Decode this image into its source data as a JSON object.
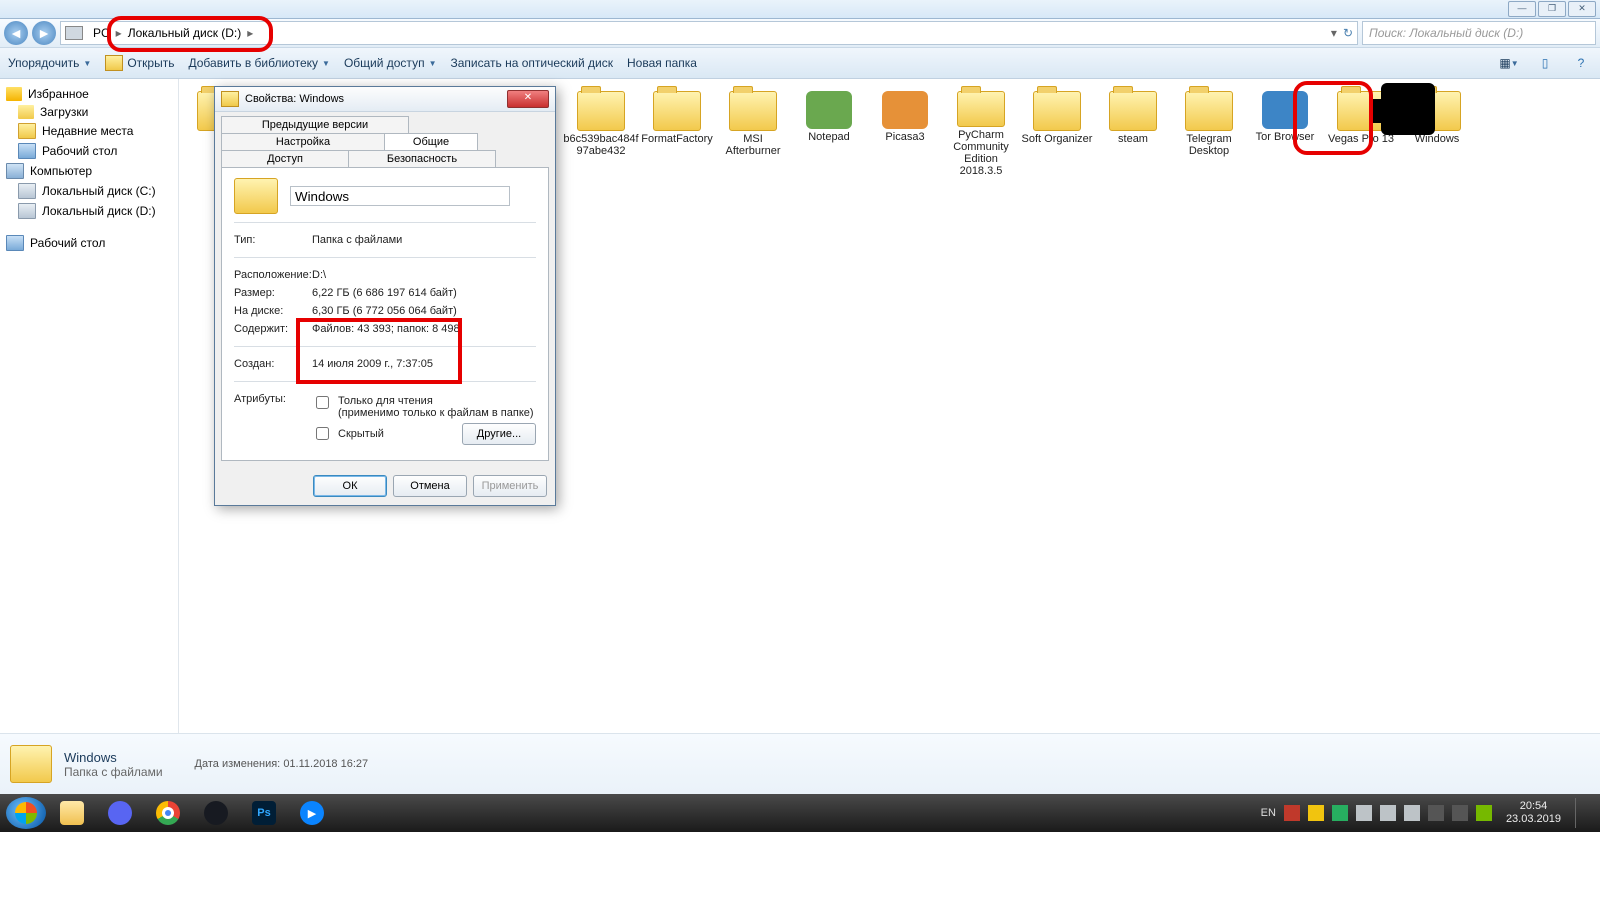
{
  "window_buttons": {
    "min": "—",
    "max": "❐",
    "close": "✕"
  },
  "breadcrumb": {
    "root": "PC",
    "disk": "Локальный диск (D:)"
  },
  "search_placeholder": "Поиск: Локальный диск (D:)",
  "toolbar": {
    "organize": "Упорядочить",
    "open": "Открыть",
    "add_library": "Добавить в библиотеку",
    "share": "Общий доступ",
    "burn": "Записать на оптический диск",
    "new_folder": "Новая папка"
  },
  "sidebar": {
    "favorites": "Избранное",
    "downloads": "Загрузки",
    "recent": "Недавние места",
    "desktop": "Рабочий стол",
    "computer": "Компьютер",
    "disk_c": "Локальный диск (C:)",
    "disk_d": "Локальный диск (D:)",
    "desktop2": "Рабочий стол"
  },
  "folders": [
    {
      "name": "",
      "type": "folder"
    },
    {
      "name": "",
      "type": "folder"
    },
    {
      "name": "",
      "type": "folder"
    },
    {
      "name": "",
      "type": "folder"
    },
    {
      "name": "",
      "type": "folder"
    },
    {
      "name": "b6c539bac484f97abe432",
      "type": "folder"
    },
    {
      "name": "FormatFactory",
      "type": "folder"
    },
    {
      "name": "MSI Afterburner",
      "type": "folder"
    },
    {
      "name": "Notepad",
      "type": "app",
      "color": "#6aa84f"
    },
    {
      "name": "Picasa3",
      "type": "app",
      "color": "#e69138"
    },
    {
      "name": "PyCharm Community Edition 2018.3.5",
      "type": "folder"
    },
    {
      "name": "Soft Organizer",
      "type": "folder"
    },
    {
      "name": "steam",
      "type": "folder"
    },
    {
      "name": "Telegram Desktop",
      "type": "folder"
    },
    {
      "name": "Tor Browser",
      "type": "app",
      "color": "#3d85c6"
    },
    {
      "name": "Vegas Pro 13",
      "type": "folder"
    },
    {
      "name": "Windows",
      "type": "folder"
    },
    {
      "name": "",
      "type": "scrib"
    }
  ],
  "dialog": {
    "title": "Свойства: Windows",
    "tabs": {
      "general": "Общие",
      "access": "Доступ",
      "security": "Безопасность",
      "prev": "Предыдущие версии",
      "config": "Настройка"
    },
    "name_value": "Windows",
    "rows": {
      "type_k": "Тип:",
      "type_v": "Папка с файлами",
      "loc_k": "Расположение:",
      "loc_v": "D:\\",
      "size_k": "Размер:",
      "size_v": "6,22 ГБ (6 686 197 614 байт)",
      "disk_k": "На диске:",
      "disk_v": "6,30 ГБ (6 772 056 064 байт)",
      "cont_k": "Содержит:",
      "cont_v": "Файлов: 43 393; папок: 8 498",
      "created_k": "Создан:",
      "created_v": "14 июля 2009 г., 7:37:05",
      "attr_k": "Атрибуты:"
    },
    "readonly": "Только для чтения",
    "readonly_note": "(применимо только к файлам в папке)",
    "hidden": "Скрытый",
    "other": "Другие...",
    "ok": "ОК",
    "cancel": "Отмена",
    "apply": "Применить"
  },
  "details": {
    "name": "Windows",
    "kind": "Папка с файлами",
    "mod_label": "Дата изменения:",
    "mod_value": "01.11.2018 16:27"
  },
  "tray": {
    "lang": "EN",
    "time": "20:54",
    "date": "23.03.2019"
  }
}
